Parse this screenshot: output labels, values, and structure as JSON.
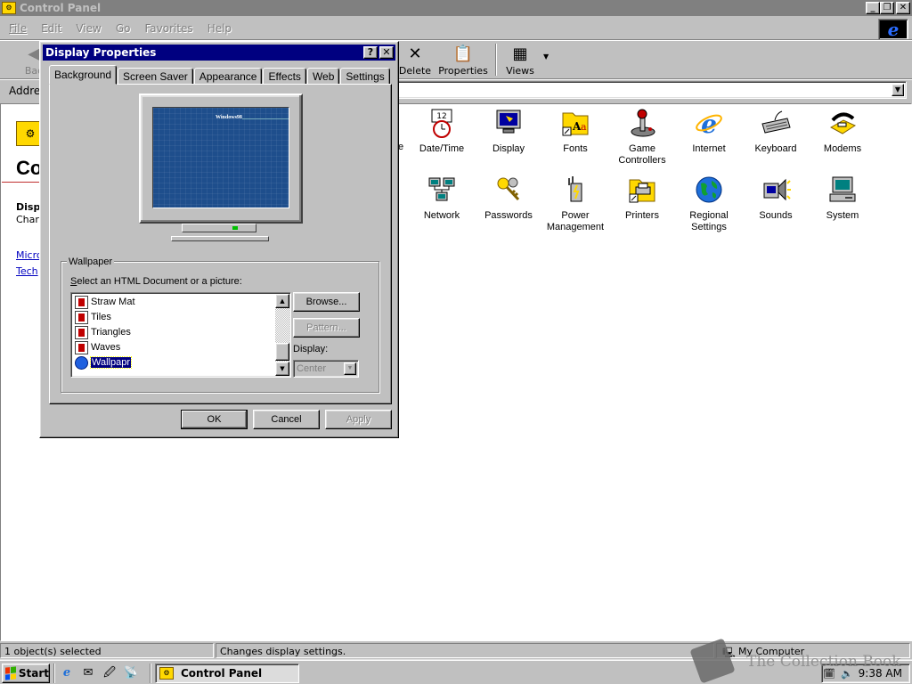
{
  "main": {
    "title": "Control Panel",
    "menu": [
      "File",
      "Edit",
      "View",
      "Go",
      "Favorites",
      "Help"
    ],
    "toolbar": {
      "back_label": "Bac",
      "delete_label": "Delete",
      "properties_label": "Properties",
      "views_label": "Views"
    },
    "address_label": "Addres",
    "left_pane": {
      "heading": "Co",
      "sub_title": "Disp",
      "sub_text": "Char",
      "links": [
        "Micro",
        "Tech"
      ]
    },
    "icons": [
      {
        "label": "Date/Time",
        "icon": "date-time-icon"
      },
      {
        "label": "Display",
        "icon": "display-icon"
      },
      {
        "label": "Fonts",
        "icon": "fonts-icon"
      },
      {
        "label": "Game Controllers",
        "icon": "joystick-icon"
      },
      {
        "label": "Internet",
        "icon": "internet-icon"
      },
      {
        "label": "Keyboard",
        "icon": "keyboard-icon"
      },
      {
        "label": "Modems",
        "icon": "modem-icon"
      },
      {
        "label": "Network",
        "icon": "network-icon"
      },
      {
        "label": "Passwords",
        "icon": "keys-icon"
      },
      {
        "label": "Power Management",
        "icon": "power-icon"
      },
      {
        "label": "Printers",
        "icon": "printer-icon"
      },
      {
        "label": "Regional Settings",
        "icon": "globe-icon"
      },
      {
        "label": "Sounds",
        "icon": "speaker-icon"
      },
      {
        "label": "System",
        "icon": "computer-icon"
      }
    ],
    "partial_label": "e",
    "status": {
      "selected": "1 object(s) selected",
      "description": "Changes display settings.",
      "zone": "My Computer"
    }
  },
  "dialog": {
    "title": "Display Properties",
    "tabs": [
      "Background",
      "Screen Saver",
      "Appearance",
      "Effects",
      "Web",
      "Settings"
    ],
    "active_tab": "Background",
    "preview_text": "Windows98",
    "wallpaper_group": "Wallpaper",
    "instruction": "Select an HTML Document or a picture:",
    "wallpapers": [
      "Straw Mat",
      "Tiles",
      "Triangles",
      "Waves",
      "Wallpapr"
    ],
    "selected_wallpaper": "Wallpapr",
    "browse_label": "Browse...",
    "pattern_label": "Pattern...",
    "display_label": "Display:",
    "display_value": "Center",
    "ok_label": "OK",
    "cancel_label": "Cancel",
    "apply_label": "Apply"
  },
  "taskbar": {
    "start_label": "Start",
    "task_label": "Control Panel",
    "clock": "9:38 AM"
  },
  "watermark": "The Collection Book",
  "colors": {
    "desktop_gray": "#c0c0c0",
    "title_active": "#000080",
    "title_inactive": "#808080",
    "selection": "#000080",
    "preview_blue": "#1e4e8c"
  }
}
